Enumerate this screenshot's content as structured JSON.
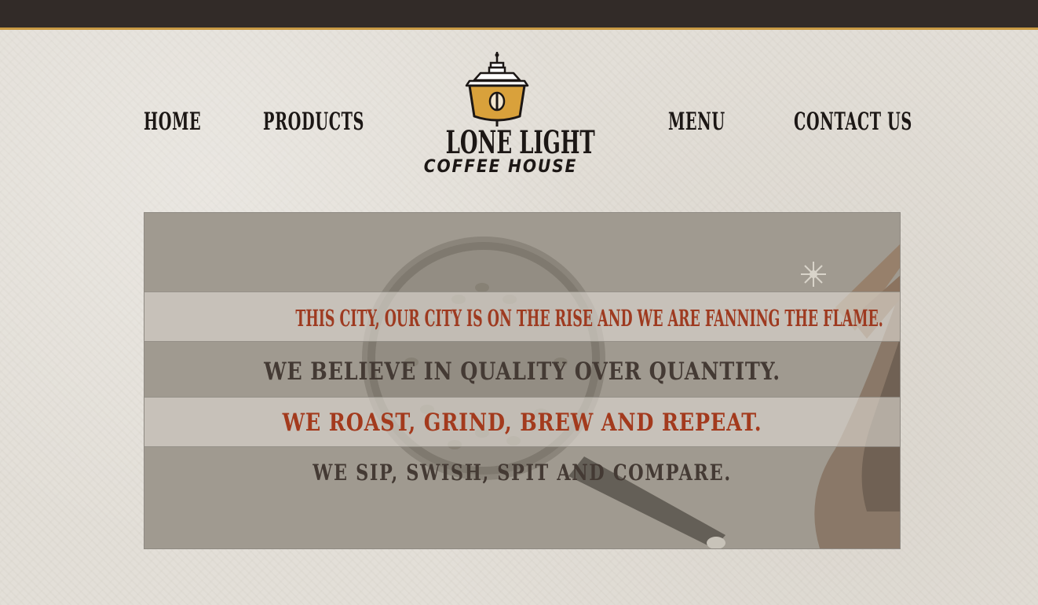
{
  "nav": {
    "home": "HOME",
    "products": "PRODUCTS",
    "menu": "MENU",
    "contact": "CONTACT US"
  },
  "logo": {
    "icon": "lantern-icon",
    "title": "LONE LIGHT",
    "subtitle": "COFFEE HOUSE"
  },
  "hero": {
    "lines": [
      "THIS CITY, OUR CITY IS ON THE RISE AND WE ARE FANNING THE FLAME.",
      "WE BELIEVE IN QUALITY OVER QUANTITY.",
      "WE ROAST, GRIND, BREW AND REPEAT.",
      "WE SIP, SWISH, SPIT AND COMPARE."
    ]
  },
  "colors": {
    "top_bar": "#322b28",
    "top_bar_accent": "#c99a43",
    "accent_red": "#9e3a20",
    "text_dark": "#443a34",
    "logo_gold": "#d9a13b"
  }
}
